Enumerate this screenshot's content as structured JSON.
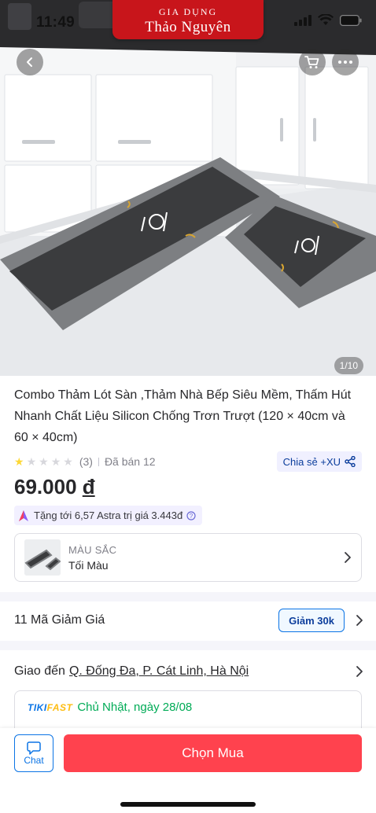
{
  "status_bar": {
    "time": "11:49"
  },
  "brand": {
    "line1": "Gia Dụng",
    "line2": "Thảo Nguyên",
    "color": "#c8151b"
  },
  "gallery": {
    "counter": "1/10"
  },
  "product": {
    "title": "Combo Thảm Lót Sàn ,Thảm Nhà Bếp Siêu Mềm, Thấm Hút Nhanh Chất Liệu Silicon Chống Trơn Trượt (120 × 40cm và 60 × 40cm)",
    "rating": 1,
    "rating_max": 5,
    "review_count": "(3)",
    "sold": "Đã bán 12",
    "share_label": "Chia sẻ +XU",
    "price": "69.000",
    "currency": "đ",
    "astra_text": "Tặng tới 6,57 Astra trị giá 3.443đ"
  },
  "variant": {
    "label": "MÀU SẮC",
    "value": "Tối Màu"
  },
  "coupons": {
    "label": "11 Mã Giảm Giá",
    "ticket": "Giảm 30k"
  },
  "shipping": {
    "label": "Giao đến",
    "address": "Q. Đống Đa, P. Cát Linh, Hà Nội",
    "service_part1": "TIKI",
    "service_part2": "FAST",
    "delivery_day": "Chủ Nhật, ngày 28/08"
  },
  "bottom_bar": {
    "chat_label": "Chat",
    "buy_label": "Chọn Mua"
  },
  "colors": {
    "buy": "#ff424e",
    "accent_blue": "#0b74e5",
    "link_blue": "#0b3d9c",
    "star": "#fdd836",
    "fast_green": "#00ab56"
  }
}
